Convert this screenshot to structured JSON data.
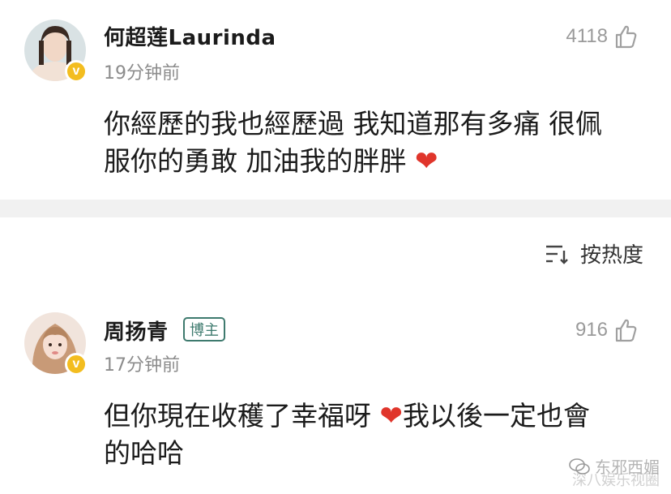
{
  "comments": [
    {
      "username": "何超莲Laurinda",
      "timestamp": "19分钟前",
      "likes": "4118",
      "verified_mark": "v",
      "body_lines": [
        "你經歷的我也經歷過 我知道那有多痛 很佩",
        "服你的勇敢 加油我的胖胖 "
      ],
      "body_emoji": "❤"
    },
    {
      "username": "周扬青",
      "badge": "博主",
      "timestamp": "17分钟前",
      "likes": "916",
      "verified_mark": "v",
      "body_lines": [
        "但你現在收穫了幸福呀 ",
        "我以後一定也會",
        "的哈哈"
      ],
      "body_emoji": "❤"
    }
  ],
  "sort": {
    "label": "按热度",
    "icon": "sort-lines-icon"
  },
  "watermark": {
    "text": "东邪西媚",
    "subtext": "深八娱乐视圈"
  },
  "colors": {
    "verified": "#f3bd1f",
    "badge": "#3e7a6e",
    "heart": "#e0352b",
    "muted": "#8c8c8c",
    "divider": "#f1f1f1"
  }
}
